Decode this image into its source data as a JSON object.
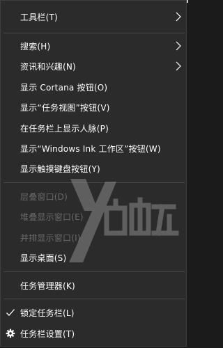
{
  "menu": {
    "items": [
      {
        "label": "工具栏(T)",
        "submenu": true
      },
      {
        "label": "搜索(H)",
        "submenu": true
      },
      {
        "label": "资讯和兴趣(N)",
        "submenu": true
      },
      {
        "label": "显示 Cortana 按钮(O)"
      },
      {
        "label": "显示“任务视图”按钮(V)"
      },
      {
        "label": "在任务栏上显示人脉(P)"
      },
      {
        "label": "显示“Windows Ink 工作区”按钮(W)"
      },
      {
        "label": "显示触摸键盘按钮(Y)"
      },
      {
        "label": "层叠窗口(D)",
        "disabled": true
      },
      {
        "label": "堆叠显示窗口(E)",
        "disabled": true
      },
      {
        "label": "并排显示窗口(I)",
        "disabled": true
      },
      {
        "label": "显示桌面(S)"
      },
      {
        "label": "任务管理器(K)"
      },
      {
        "label": "锁定任务栏(L)",
        "icon": "check-icon"
      },
      {
        "label": "任务栏设置(T)",
        "icon": "gear-icon"
      }
    ]
  },
  "colors": {
    "background": "#2b2b2b",
    "text": "#ffffff",
    "disabled_text": "#6a6a6a",
    "separator": "#4a4a4a"
  }
}
